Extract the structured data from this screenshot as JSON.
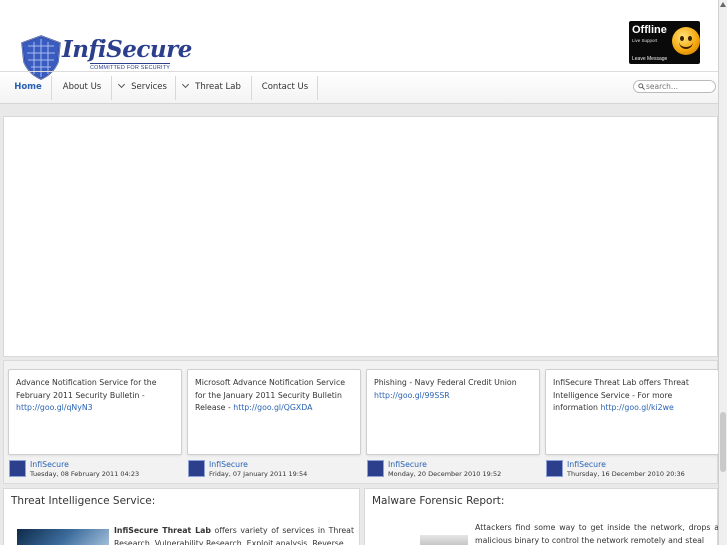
{
  "header": {
    "logo_word": "InfiSecure",
    "logo_tagline": "COMMITTED FOR SECURITY",
    "support": {
      "status": "Offline",
      "subtitle": "Live Support",
      "action": "Leave Message"
    }
  },
  "nav": {
    "items": [
      {
        "label": "Home",
        "active": true,
        "has_dropdown": false
      },
      {
        "label": "About Us",
        "active": false,
        "has_dropdown": false
      },
      {
        "label": "Services",
        "active": false,
        "has_dropdown": true
      },
      {
        "label": "Threat Lab",
        "active": false,
        "has_dropdown": true
      },
      {
        "label": "Contact Us",
        "active": false,
        "has_dropdown": false
      }
    ],
    "search_placeholder": "search..."
  },
  "news": [
    {
      "text": "Advance Notification Service for the February 2011 Security Bulletin -",
      "link": "http://goo.gl/qNyN3",
      "author": "InfiSecure",
      "date": "Tuesday, 08 February 2011 04:23"
    },
    {
      "text": "Microsoft Advance Notification Service for the January 2011 Security Bulletin Release -",
      "link": "http://goo.gl/QGXDA",
      "author": "InfiSecure",
      "date": "Friday, 07 January 2011 19:54"
    },
    {
      "text": "Phishing - Navy Federal Credit Union",
      "link": "http://goo.gl/99SSR",
      "author": "InfiSecure",
      "date": "Monday, 20 December 2010 19:52"
    },
    {
      "text": "InfiSecure Threat Lab offers Threat Intelligence Service - For more information",
      "link": "http://goo.gl/ki2we",
      "author": "InfiSecure",
      "date": "Thursday, 16 December 2010 20:36"
    }
  ],
  "panels": {
    "threat": {
      "title": "Threat Intelligence Service:",
      "lead": "InfiSecure Threat Lab",
      "body": " offers variety of services in Threat Research, Vulnerability Research, Exploit analysis, Reverse"
    },
    "malware": {
      "title": "Malware Forensic Report:",
      "body": "Attackers find some way to get inside the network, drops a malicious binary to control the network remotely and steal"
    }
  },
  "colors": {
    "brand": "#2b3f8c",
    "link": "#2a62b3"
  }
}
